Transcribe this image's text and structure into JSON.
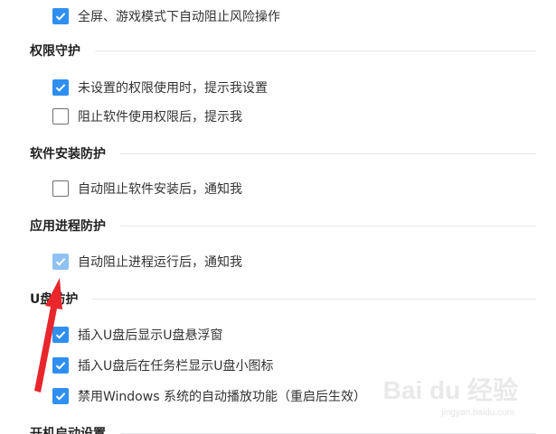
{
  "options": [
    {
      "label": "全屏、游戏模式下自动阻止风险操作",
      "state": "checked"
    },
    {
      "label": "未设置的权限使用时，提示我设置",
      "state": "checked"
    },
    {
      "label": "阻止软件使用权限后，提示我",
      "state": "unchecked"
    },
    {
      "label": "自动阻止软件安装后，通知我",
      "state": "unchecked"
    },
    {
      "label": "自动阻止进程运行后，通知我",
      "state": "checked"
    },
    {
      "label": "插入U盘后显示U盘悬浮窗",
      "state": "checked"
    },
    {
      "label": "插入U盘后在任务栏显示U盘小图标",
      "state": "checked"
    },
    {
      "label": "禁用Windows 系统的自动播放功能（重启后生效）",
      "state": "checked"
    }
  ],
  "sections": {
    "permission_guard": "权限守护",
    "software_install": "软件安装防护",
    "app_process": "应用进程防护",
    "usb": "U盘防护",
    "startup": "开机启动设置"
  },
  "watermark": {
    "logo": "Bai du 经验",
    "url": "jingyan.baidu.com"
  },
  "colors": {
    "checkbox_checked": "#2f8ff0",
    "checkbox_checked_hover": "#8fc2f3",
    "annotation_arrow": "#e8262c"
  }
}
